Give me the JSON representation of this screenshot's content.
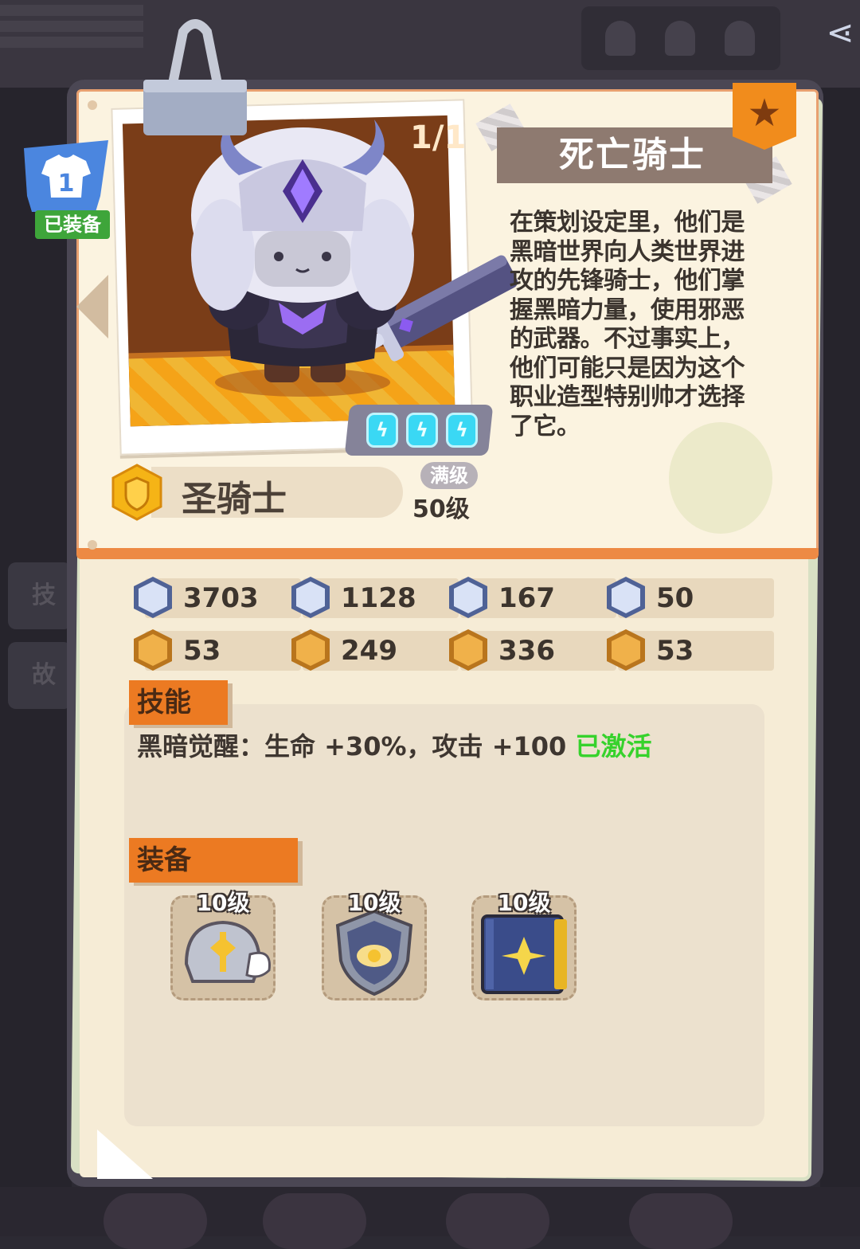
{
  "character": {
    "name": "死亡骑士",
    "count": "1/1",
    "class_name": "圣骑士",
    "max_label": "满级",
    "level": "50级",
    "equipped_slot": "1",
    "equipped_label": "已装备",
    "description": "在策划设定里，他们是黑暗世界向人类世界进攻的先锋骑士，他们掌握黑暗力量，使用邪恶的武器。不过事实上，他们可能只是因为这个职业造型特别帅才选择了它。",
    "energy_count": 3
  },
  "stats": [
    {
      "icon": "health-icon",
      "value": "3703"
    },
    {
      "icon": "attack-icon",
      "value": "1128"
    },
    {
      "icon": "defense-icon",
      "value": "167"
    },
    {
      "icon": "anchor-icon",
      "value": "50"
    },
    {
      "icon": "strength-icon",
      "value": "53"
    },
    {
      "icon": "smile-icon",
      "value": "249"
    },
    {
      "icon": "muscle-icon",
      "value": "336"
    },
    {
      "icon": "brain-icon",
      "value": "53"
    }
  ],
  "skills": {
    "title": "技能",
    "entry": "黑暗觉醒：生命 +30%，攻击 +100",
    "status": "已激活"
  },
  "equipment": {
    "title": "装备",
    "items": [
      {
        "icon": "winged-helmet-icon",
        "level": "10级"
      },
      {
        "icon": "winged-shield-icon",
        "level": "10级"
      },
      {
        "icon": "holy-book-icon",
        "level": "10级"
      }
    ]
  },
  "sidebar": {
    "tab1": "技",
    "tab2": "故"
  },
  "colors": {
    "accent": "#ec7a22",
    "active_green": "#36d22c",
    "page": "#f6ecd6",
    "frame": "#4b4754"
  }
}
